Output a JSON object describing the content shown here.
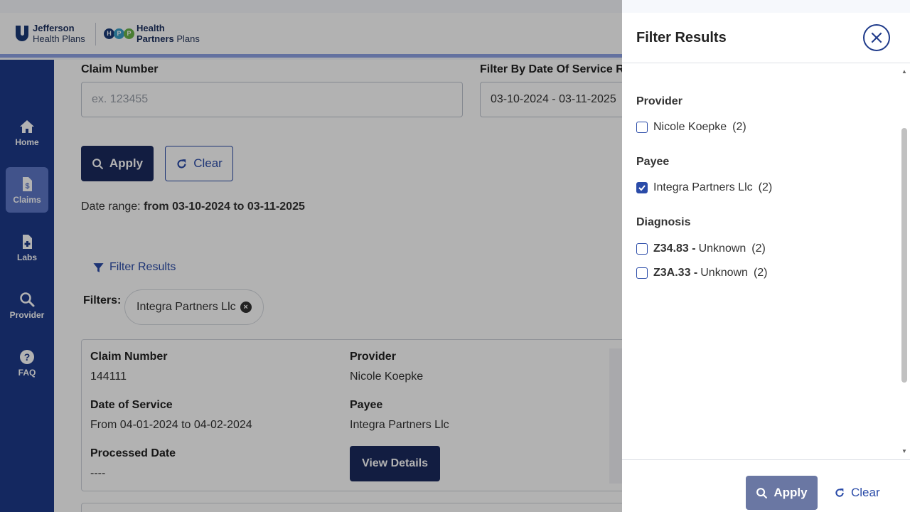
{
  "header": {
    "logo1_line1": "Jefferson",
    "logo1_line2": "Health Plans",
    "logo2_line1": "Health",
    "logo2_line2_bold": "Partners",
    "logo2_line2": "Plans",
    "hpp_letters": [
      "H",
      "P",
      "P"
    ],
    "hpp_colors": [
      "#1b3a78",
      "#3aa0c8",
      "#6bb34a"
    ]
  },
  "sidebar": {
    "items": [
      {
        "label": "Home",
        "icon": "home-icon",
        "active": false
      },
      {
        "label": "Claims",
        "icon": "claims-icon",
        "active": true
      },
      {
        "label": "Labs",
        "icon": "labs-icon",
        "active": false
      },
      {
        "label": "Provider",
        "icon": "search-icon",
        "active": false
      },
      {
        "label": "FAQ",
        "icon": "help-icon",
        "active": false
      }
    ]
  },
  "search": {
    "claim_number_label": "Claim Number",
    "claim_number_placeholder": "ex. 123455",
    "date_label": "Filter By Date Of Service R",
    "date_value": "03-10-2024 - 03-11-2025",
    "apply_label": "Apply",
    "clear_label": "Clear",
    "date_range_prefix": "Date range:",
    "date_range_value": "from 03-10-2024 to 03-11-2025"
  },
  "filters": {
    "filter_link": "Filter Results",
    "filters_label": "Filters:",
    "chip_label": "Integra Partners Llc",
    "chip_close": "×"
  },
  "claim_card": {
    "claim_number_label": "Claim Number",
    "claim_number": "144111",
    "provider_label": "Provider",
    "provider": "Nicole Koepke",
    "date_of_service_label": "Date of Service",
    "date_of_service": "From 04-01-2024 to 04-02-2024",
    "payee_label": "Payee",
    "payee": "Integra Partners Llc",
    "processed_date_label": "Processed Date",
    "processed_date": "----",
    "view_details_label": "View Details"
  },
  "panel": {
    "title": "Filter Results",
    "provider_title": "Provider",
    "provider_options": [
      {
        "label": "Nicole Koepke",
        "count": "(2)",
        "checked": false
      }
    ],
    "payee_title": "Payee",
    "payee_options": [
      {
        "label": "Integra Partners Llc",
        "count": "(2)",
        "checked": true
      }
    ],
    "diagnosis_title": "Diagnosis",
    "diagnosis_options": [
      {
        "code": "Z34.83 -",
        "label": "Unknown",
        "count": "(2)",
        "checked": false
      },
      {
        "code": "Z3A.33 -",
        "label": "Unknown",
        "count": "(2)",
        "checked": false
      }
    ],
    "apply_label": "Apply",
    "clear_label": "Clear",
    "colors": {
      "primary": "#1e3a8a",
      "checkbox": "#2a4ba8",
      "apply_bg": "#6a77a3"
    }
  }
}
